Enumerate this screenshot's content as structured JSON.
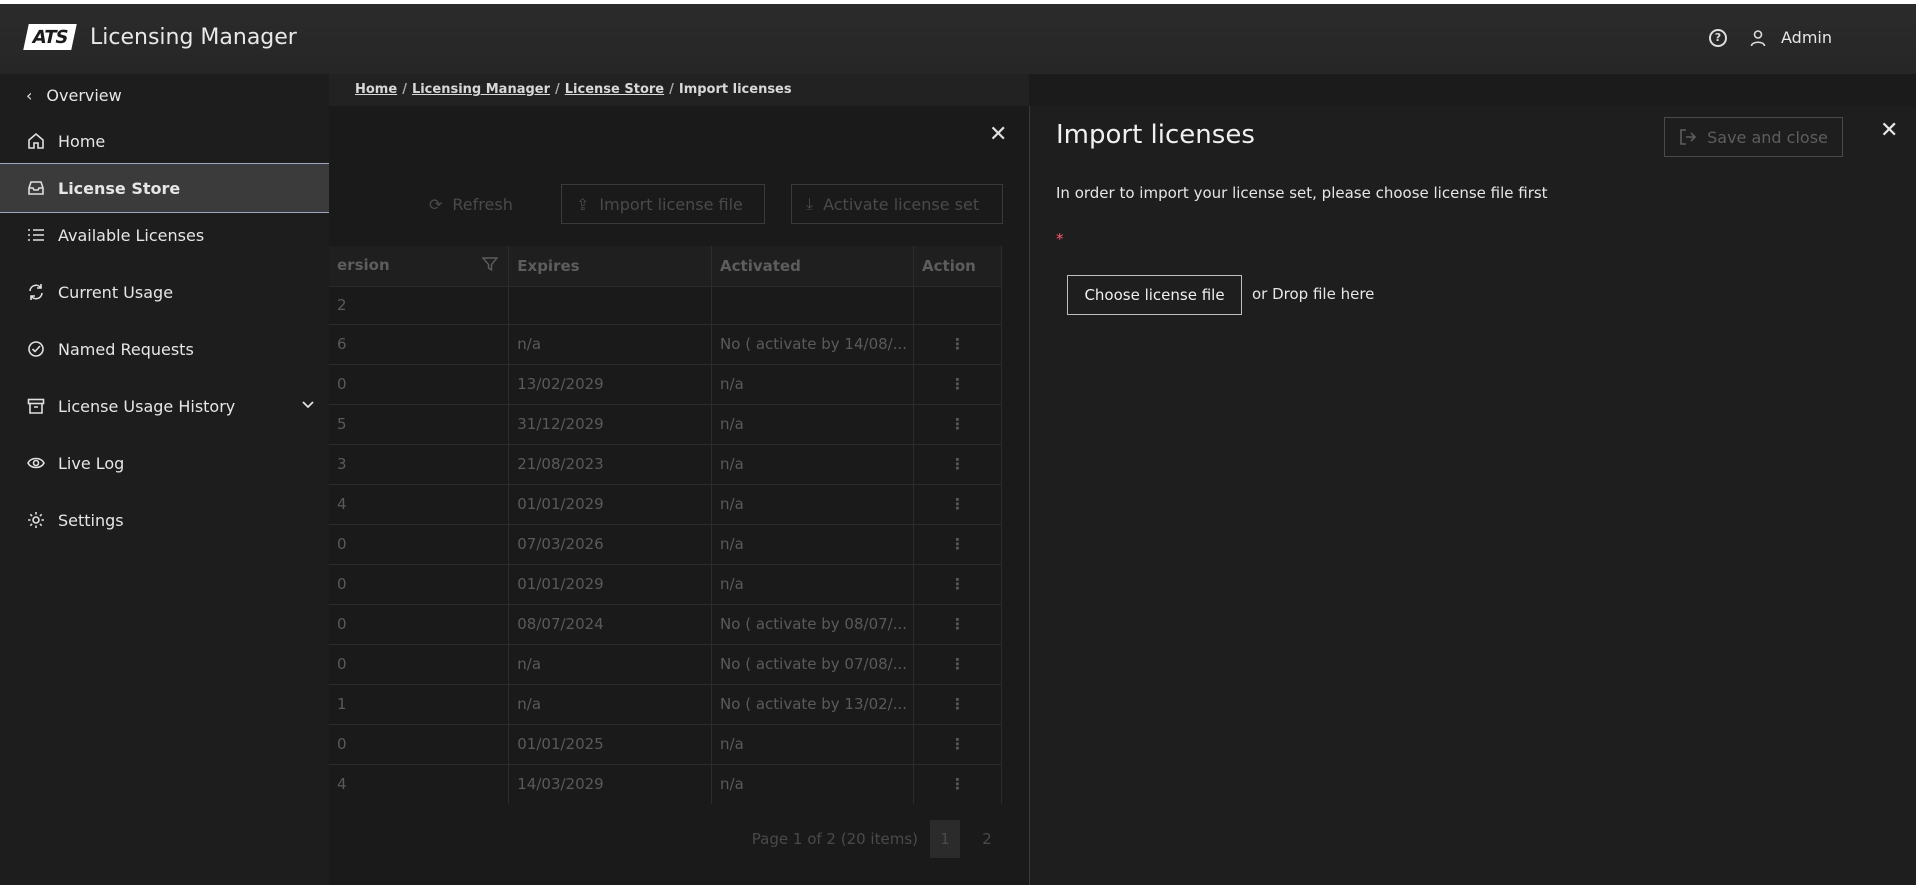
{
  "header": {
    "logo_text": "ATS",
    "app_title": "Licensing Manager",
    "help_icon": "help-icon",
    "user_name": "Admin"
  },
  "sidebar": {
    "overview_label": "Overview",
    "items": [
      {
        "label": "Home",
        "icon": "home-icon"
      },
      {
        "label": "License Store",
        "icon": "inbox-icon",
        "active": true
      },
      {
        "label": "Available Licenses",
        "icon": "list-icon"
      },
      {
        "label": "Current Usage",
        "icon": "refresh-icon"
      },
      {
        "label": "Named Requests",
        "icon": "check-circle-icon"
      },
      {
        "label": "License Usage History",
        "icon": "archive-icon",
        "expandable": true
      },
      {
        "label": "Live Log",
        "icon": "eye-icon"
      },
      {
        "label": "Settings",
        "icon": "gear-icon"
      }
    ]
  },
  "breadcrumb": {
    "items": [
      "Home",
      "Licensing Manager",
      "License Store"
    ],
    "current": "Import licenses"
  },
  "background_list": {
    "toolbar": {
      "refresh_label": "Refresh",
      "import_label": "Import license file",
      "activate_label": "Activate license set"
    },
    "columns": [
      "ersion",
      "Expires",
      "Activated",
      "Action"
    ],
    "filter_row": [
      "2",
      "",
      "",
      ""
    ],
    "rows": [
      [
        "6",
        "n/a",
        "No ( activate by 14/08/..."
      ],
      [
        "0",
        "13/02/2029",
        "n/a"
      ],
      [
        "5",
        "31/12/2029",
        "n/a"
      ],
      [
        "3",
        "21/08/2023",
        "n/a"
      ],
      [
        "4",
        "01/01/2029",
        "n/a"
      ],
      [
        "0",
        "07/03/2026",
        "n/a"
      ],
      [
        "0",
        "01/01/2029",
        "n/a"
      ],
      [
        "0",
        "08/07/2024",
        "No ( activate by 08/07/..."
      ],
      [
        "0",
        "n/a",
        "No ( activate by 07/08/..."
      ],
      [
        "1",
        "n/a",
        "No ( activate by 13/02/..."
      ],
      [
        "0",
        "01/01/2025",
        "n/a"
      ],
      [
        "4",
        "14/03/2029",
        "n/a"
      ]
    ],
    "pager": {
      "summary": "Page 1 of 2 (20 items)",
      "pages": [
        "1",
        "2"
      ],
      "current_page": 1
    }
  },
  "panel": {
    "title": "Import licenses",
    "save_label": "Save and close",
    "hint": "In order to import your license set, please choose license file first",
    "required_mark": "*",
    "choose_label": "Choose license file",
    "drop_text": "or Drop file here"
  },
  "colors": {
    "background": "#1b1b1b",
    "header": "#2b2b2b",
    "active_item": "#3b3b3b",
    "required": "#ff5a6e"
  }
}
